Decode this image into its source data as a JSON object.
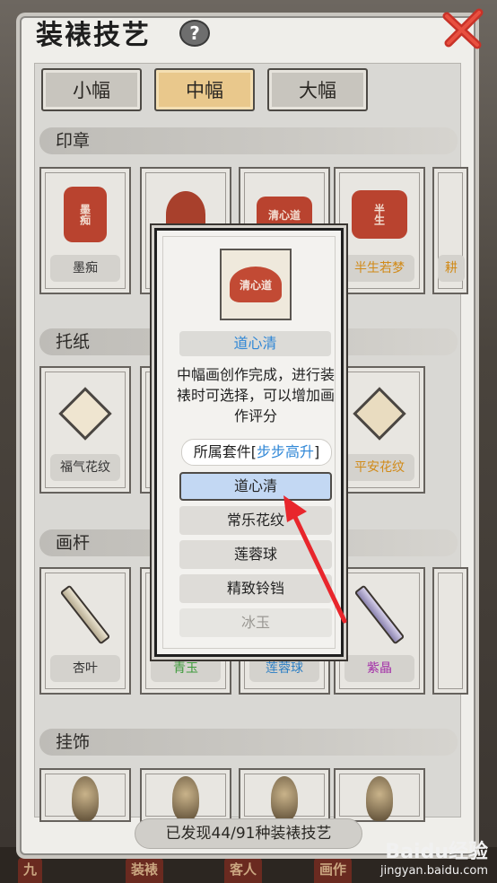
{
  "header": {
    "title": "装裱技艺",
    "help_label": "?"
  },
  "size_tabs": [
    {
      "label": "小幅",
      "active": false
    },
    {
      "label": "中幅",
      "active": true
    },
    {
      "label": "大幅",
      "active": false
    }
  ],
  "sections": {
    "seal": {
      "title": "印章",
      "items": [
        {
          "label": "墨痴",
          "art": "墨痴"
        },
        {
          "label": "",
          "art": ""
        },
        {
          "label": "",
          "art": "清心道"
        },
        {
          "label": "半生若梦",
          "art": "半生"
        },
        {
          "label": "耕",
          "art": ""
        }
      ]
    },
    "backing": {
      "title": "托纸",
      "items": [
        {
          "label": "福气花纹"
        },
        {
          "label": ""
        },
        {
          "label": ""
        },
        {
          "label": "平安花纹"
        }
      ]
    },
    "rod": {
      "title": "画杆",
      "items": [
        {
          "label": "杏叶"
        },
        {
          "label": "青玉"
        },
        {
          "label": "莲蓉球"
        },
        {
          "label": "紫晶"
        }
      ]
    },
    "pendant": {
      "title": "挂饰"
    }
  },
  "footer": {
    "discovered_text": "已发现44/91种装裱技艺"
  },
  "bottom_tabs": [
    "九",
    "装裱",
    "客人",
    "画作"
  ],
  "popup": {
    "thumb_text": "清心道",
    "name": "道心清",
    "description": "中幅画创作完成，进行装裱时可选择，可以增加画作评分",
    "set_prefix": "所属套件[",
    "set_name": "步步高升",
    "set_suffix": "]",
    "options": [
      {
        "label": "道心清",
        "state": "selected"
      },
      {
        "label": "常乐花纹",
        "state": "normal"
      },
      {
        "label": "莲蓉球",
        "state": "normal"
      },
      {
        "label": "精致铃铛",
        "state": "normal"
      },
      {
        "label": "冰玉",
        "state": "disabled"
      }
    ]
  },
  "watermark": {
    "logo": "Baidu经验",
    "url": "jingyan.baidu.com"
  },
  "colors": {
    "accent_blue": "#2e86d6",
    "active_tab": "#e9c88c",
    "seal_red": "#b9432f",
    "arrow_red": "#e8262c"
  }
}
